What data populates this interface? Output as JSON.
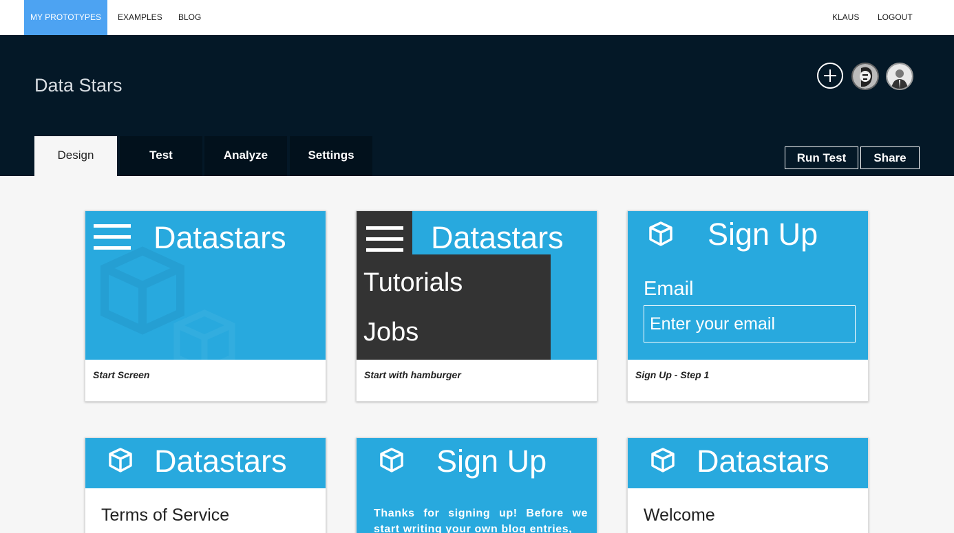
{
  "topnav": {
    "my_prototypes": "MY PROTOTYPES",
    "examples": "EXAMPLES",
    "blog": "BLOG",
    "user": "KLAUS",
    "logout": "LOGOUT"
  },
  "header": {
    "title": "Data Stars",
    "tabs": [
      "Design",
      "Test",
      "Analyze",
      "Settings"
    ],
    "run_test": "Run Test",
    "share": "Share"
  },
  "colors": {
    "accent": "#4da3f2",
    "header_bg": "#041827",
    "card_blue": "#28a9de"
  },
  "cards": [
    {
      "caption": "Start Screen",
      "app_title": "Datastars"
    },
    {
      "caption": "Start with hamburger",
      "app_title": "Datastars",
      "menu": [
        "Tutorials",
        "Jobs"
      ]
    },
    {
      "caption": "Sign Up - Step 1",
      "app_title": "Sign Up",
      "email_label": "Email",
      "email_placeholder": "Enter your email"
    },
    {
      "app_title": "Datastars",
      "body": "Terms of Service"
    },
    {
      "app_title": "Sign Up",
      "body": "Thanks for signing up! Before we start writing your own blog entries,"
    },
    {
      "app_title": "Datastars",
      "body": "Welcome"
    }
  ]
}
